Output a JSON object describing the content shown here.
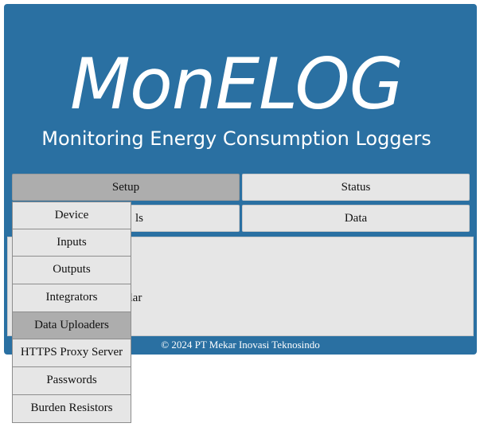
{
  "header": {
    "logo_text": "MonELOG",
    "subtitle": "Monitoring Energy Consumption Loggers"
  },
  "nav": {
    "setup_label": "Setup",
    "status_label": "Status",
    "tools_label_visible": "ls",
    "data_label": "Data"
  },
  "content": {
    "partial_text": "olar"
  },
  "footer": {
    "copyright": "© 2024 PT Mekar Inovasi Teknosindo"
  },
  "setup_menu": {
    "items": [
      {
        "label": "Device"
      },
      {
        "label": "Inputs"
      },
      {
        "label": "Outputs"
      },
      {
        "label": "Integrators"
      },
      {
        "label": "Data Uploaders"
      },
      {
        "label": "HTTPS Proxy Server"
      },
      {
        "label": "Passwords"
      },
      {
        "label": "Burden Resistors"
      }
    ],
    "hovered_item": "Data Uploaders"
  },
  "colors": {
    "header_bg": "#2a70a2",
    "tab_bg": "#e6e6e6",
    "tab_active_bg": "#adadad"
  }
}
